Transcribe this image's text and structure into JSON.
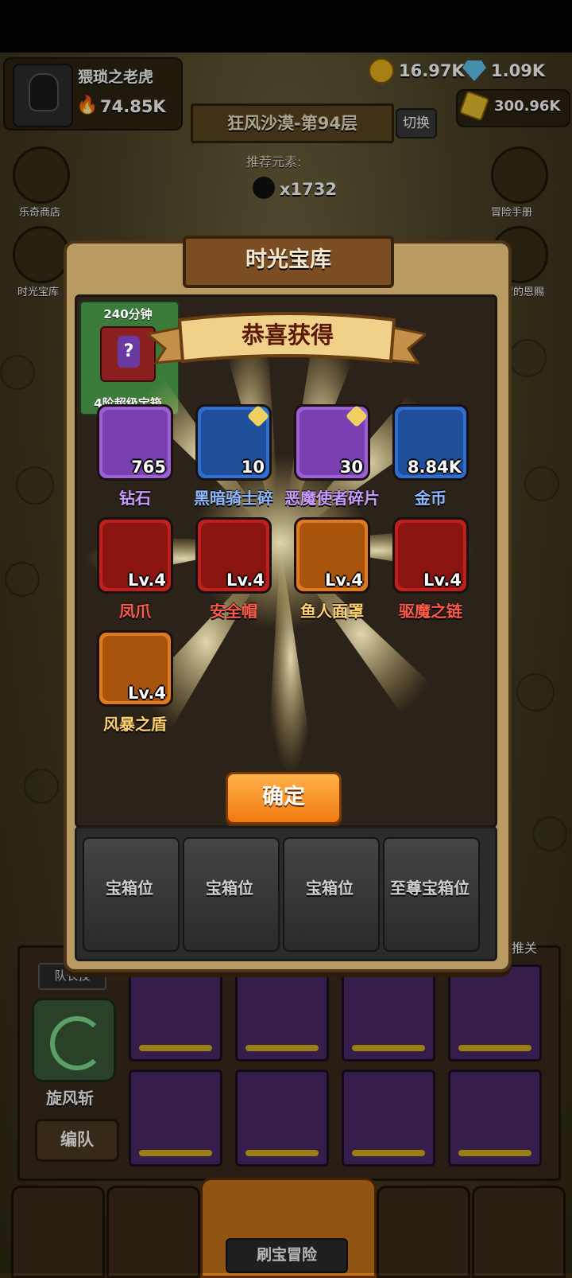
{
  "player": {
    "name": "猥琐之老虎",
    "power": "74.85K"
  },
  "currency": {
    "coins": "16.97K",
    "gems": "1.09K",
    "gold": "300.96K"
  },
  "stage": {
    "title": "狂风沙漠-第94层",
    "switch_label": "切换",
    "recommend_label": "推荐元素:",
    "kill_count": "x1732"
  },
  "side": {
    "left1": "乐奇商店",
    "left2": "时光宝库",
    "right1": "冒险手册",
    "right2": "卡蒙的恩赐"
  },
  "modal": {
    "title": "时光宝库",
    "timer_card": {
      "time": "240分钟",
      "label": "4阶超级宝箱"
    },
    "ribbon": "恭喜获得",
    "items": [
      {
        "name": "钻石",
        "value": "765",
        "color": "#9c5fd6",
        "name_color": "#c99bff",
        "icon": "diamond-icon"
      },
      {
        "name": "黑暗骑士碎",
        "value": "10",
        "color": "#2f6fd0",
        "name_color": "#8fb8ff",
        "icon": "dark-knight-icon"
      },
      {
        "name": "恶魔使者碎片",
        "value": "30",
        "color": "#9c5fd6",
        "name_color": "#c99bff",
        "icon": "demon-envoy-icon"
      },
      {
        "name": "金币",
        "value": "8.84K",
        "color": "#2f6fd0",
        "name_color": "#8fb8ff",
        "icon": "gold-coin-icon"
      },
      {
        "name": "凤爪",
        "value": "Lv.4",
        "color": "#c0201c",
        "name_color": "#ff5a4a",
        "icon": "phoenix-claw-icon"
      },
      {
        "name": "安全帽",
        "value": "Lv.4",
        "color": "#c0201c",
        "name_color": "#ff5a4a",
        "icon": "safety-helmet-icon"
      },
      {
        "name": "鱼人面罩",
        "value": "Lv.4",
        "color": "#e07a1c",
        "name_color": "#ffd070",
        "icon": "fishman-mask-icon"
      },
      {
        "name": "驱魔之链",
        "value": "Lv.4",
        "color": "#c0201c",
        "name_color": "#ff5a4a",
        "icon": "exorcism-chain-icon"
      },
      {
        "name": "风暴之盾",
        "value": "Lv.4",
        "color": "#e07a1c",
        "name_color": "#ffd070",
        "icon": "storm-shield-icon"
      }
    ],
    "confirm_label": "确定",
    "chest_slots": [
      "宝箱位",
      "宝箱位",
      "宝箱位",
      "至尊宝箱位"
    ]
  },
  "team": {
    "leader_label": "队长技",
    "skill_name": "旋风斩",
    "team_button": "编队",
    "auto_label": "动推关"
  },
  "nav": {
    "center_label": "刷宝冒险"
  }
}
